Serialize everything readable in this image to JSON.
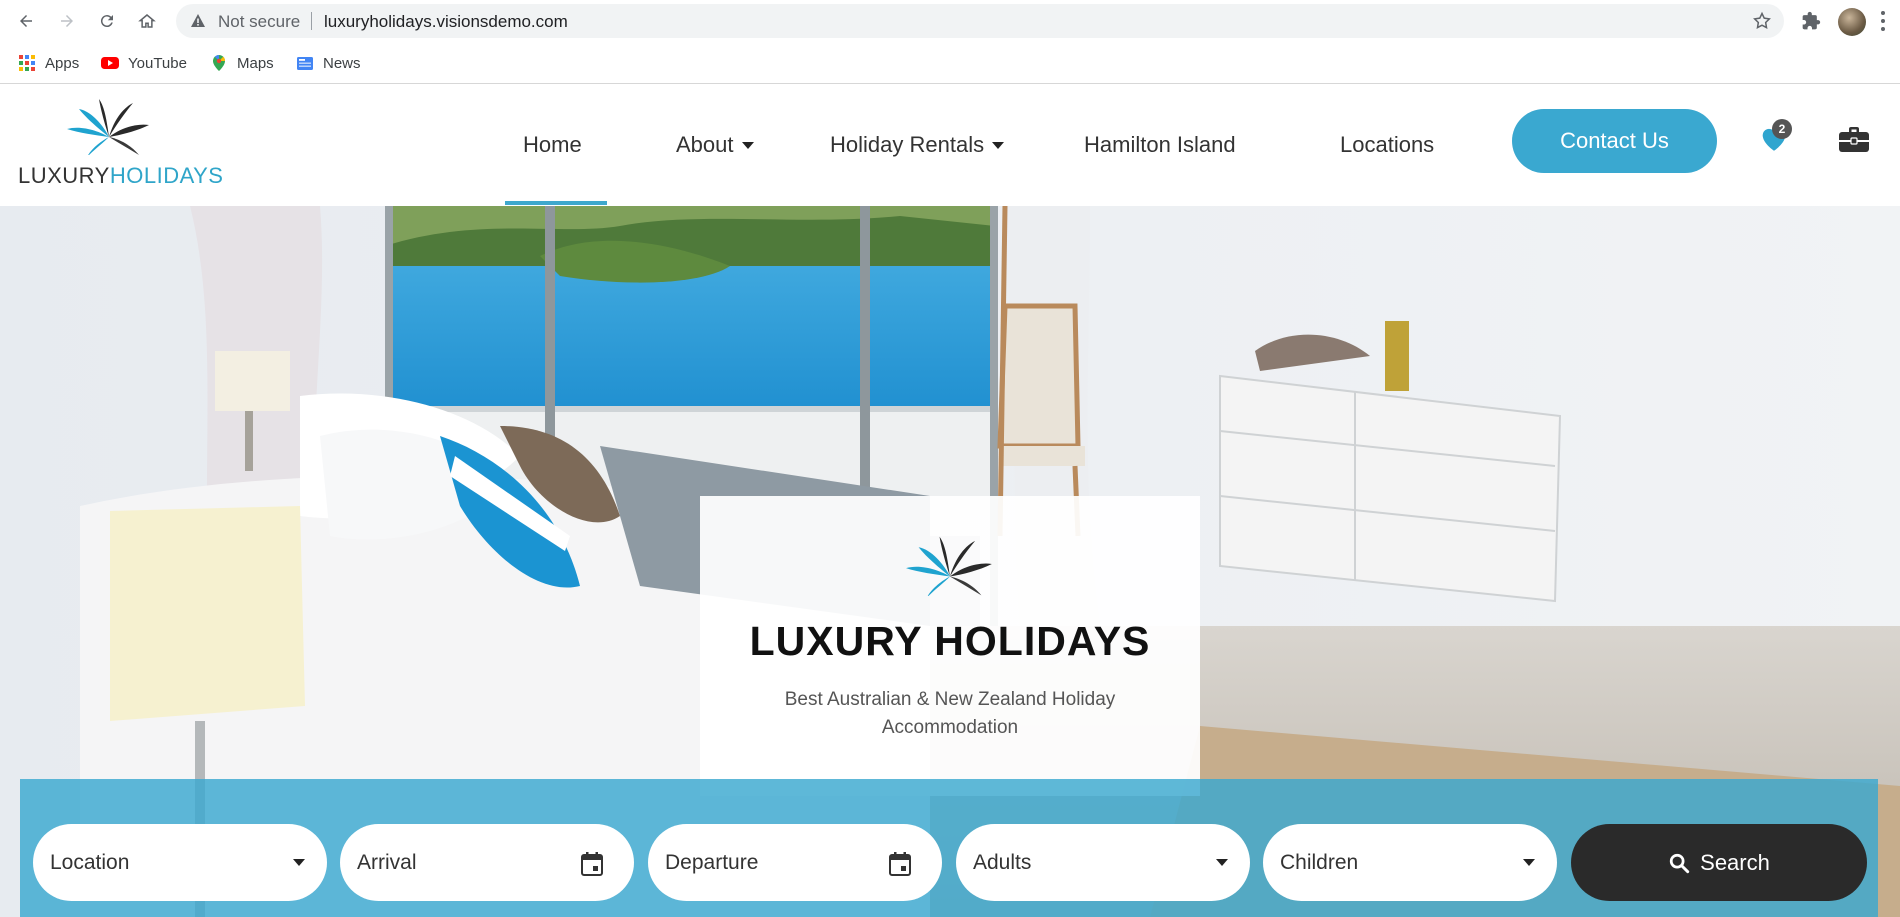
{
  "browser": {
    "security_label": "Not secure",
    "url": "luxuryholidays.visionsdemo.com",
    "bookmarks": [
      {
        "label": "Apps",
        "icon": "apps-grid-icon"
      },
      {
        "label": "YouTube",
        "icon": "youtube-icon"
      },
      {
        "label": "Maps",
        "icon": "maps-pin-icon"
      },
      {
        "label": "News",
        "icon": "news-icon"
      }
    ]
  },
  "site": {
    "logo_part1": "LUXURY",
    "logo_part2": "HOLIDAYS",
    "brand_color": "#3aa8d0",
    "nav": {
      "home": "Home",
      "about": "About",
      "holiday_rentals": "Holiday Rentals",
      "hamilton_island": "Hamilton Island",
      "locations": "Locations",
      "contact": "Contact Us",
      "active": "Home"
    },
    "wishlist_count": "2"
  },
  "hero": {
    "title": "LUXURY HOLIDAYS",
    "subtitle": "Best Australian & New Zealand Holiday Accommodation"
  },
  "search": {
    "location": "Location",
    "arrival": "Arrival",
    "departure": "Departure",
    "adults": "Adults",
    "children": "Children",
    "button": "Search"
  }
}
